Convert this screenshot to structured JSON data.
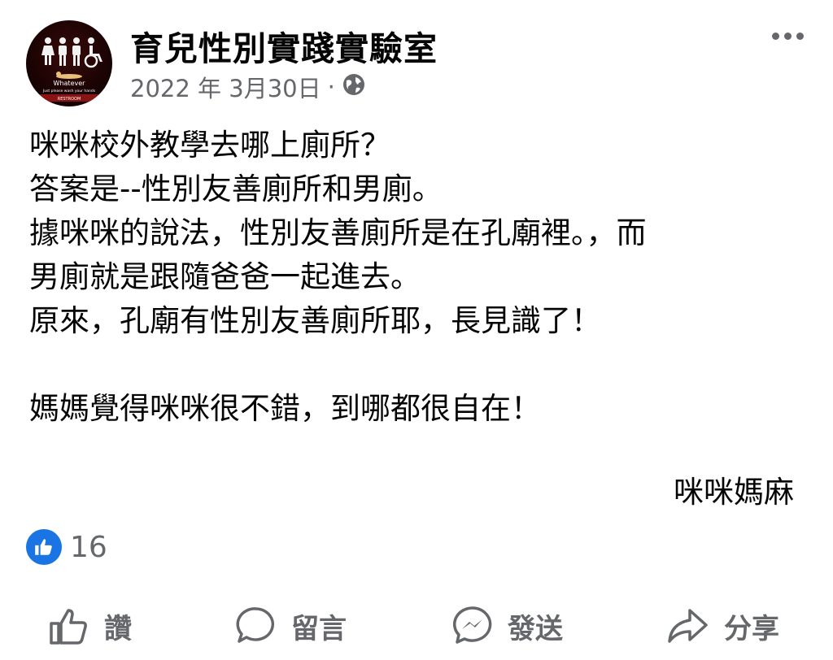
{
  "header": {
    "page_name": "育兒性別實踐實驗室",
    "date": "2022 年 3月30日",
    "separator": "·",
    "audience_icon": "globe-icon",
    "avatar": {
      "sign_text": "Whatever",
      "sign_subtext": "Just please wash your hands",
      "sign_footer": "RESTROOM"
    }
  },
  "post": {
    "lines": [
      "咪咪校外教學去哪上廁所？",
      "答案是--性別友善廁所和男廁。",
      "據咪咪的說法，性別友善廁所是在孔廟裡。，而",
      "男廁就是跟隨爸爸一起進去。",
      "原來，孔廟有性別友善廁所耶，長見識了！",
      "",
      "媽媽覺得咪咪很不錯，到哪都很自在！"
    ],
    "signature": "咪咪媽麻"
  },
  "reactions": {
    "icon": "like-icon",
    "count": "16"
  },
  "actions": [
    {
      "icon": "thumbs-up-icon",
      "label": "讚"
    },
    {
      "icon": "comment-icon",
      "label": "留言"
    },
    {
      "icon": "messenger-icon",
      "label": "發送"
    },
    {
      "icon": "share-icon",
      "label": "分享"
    }
  ],
  "colors": {
    "accent": "#1b74e4",
    "secondary_text": "#65676b",
    "text": "#050505"
  }
}
